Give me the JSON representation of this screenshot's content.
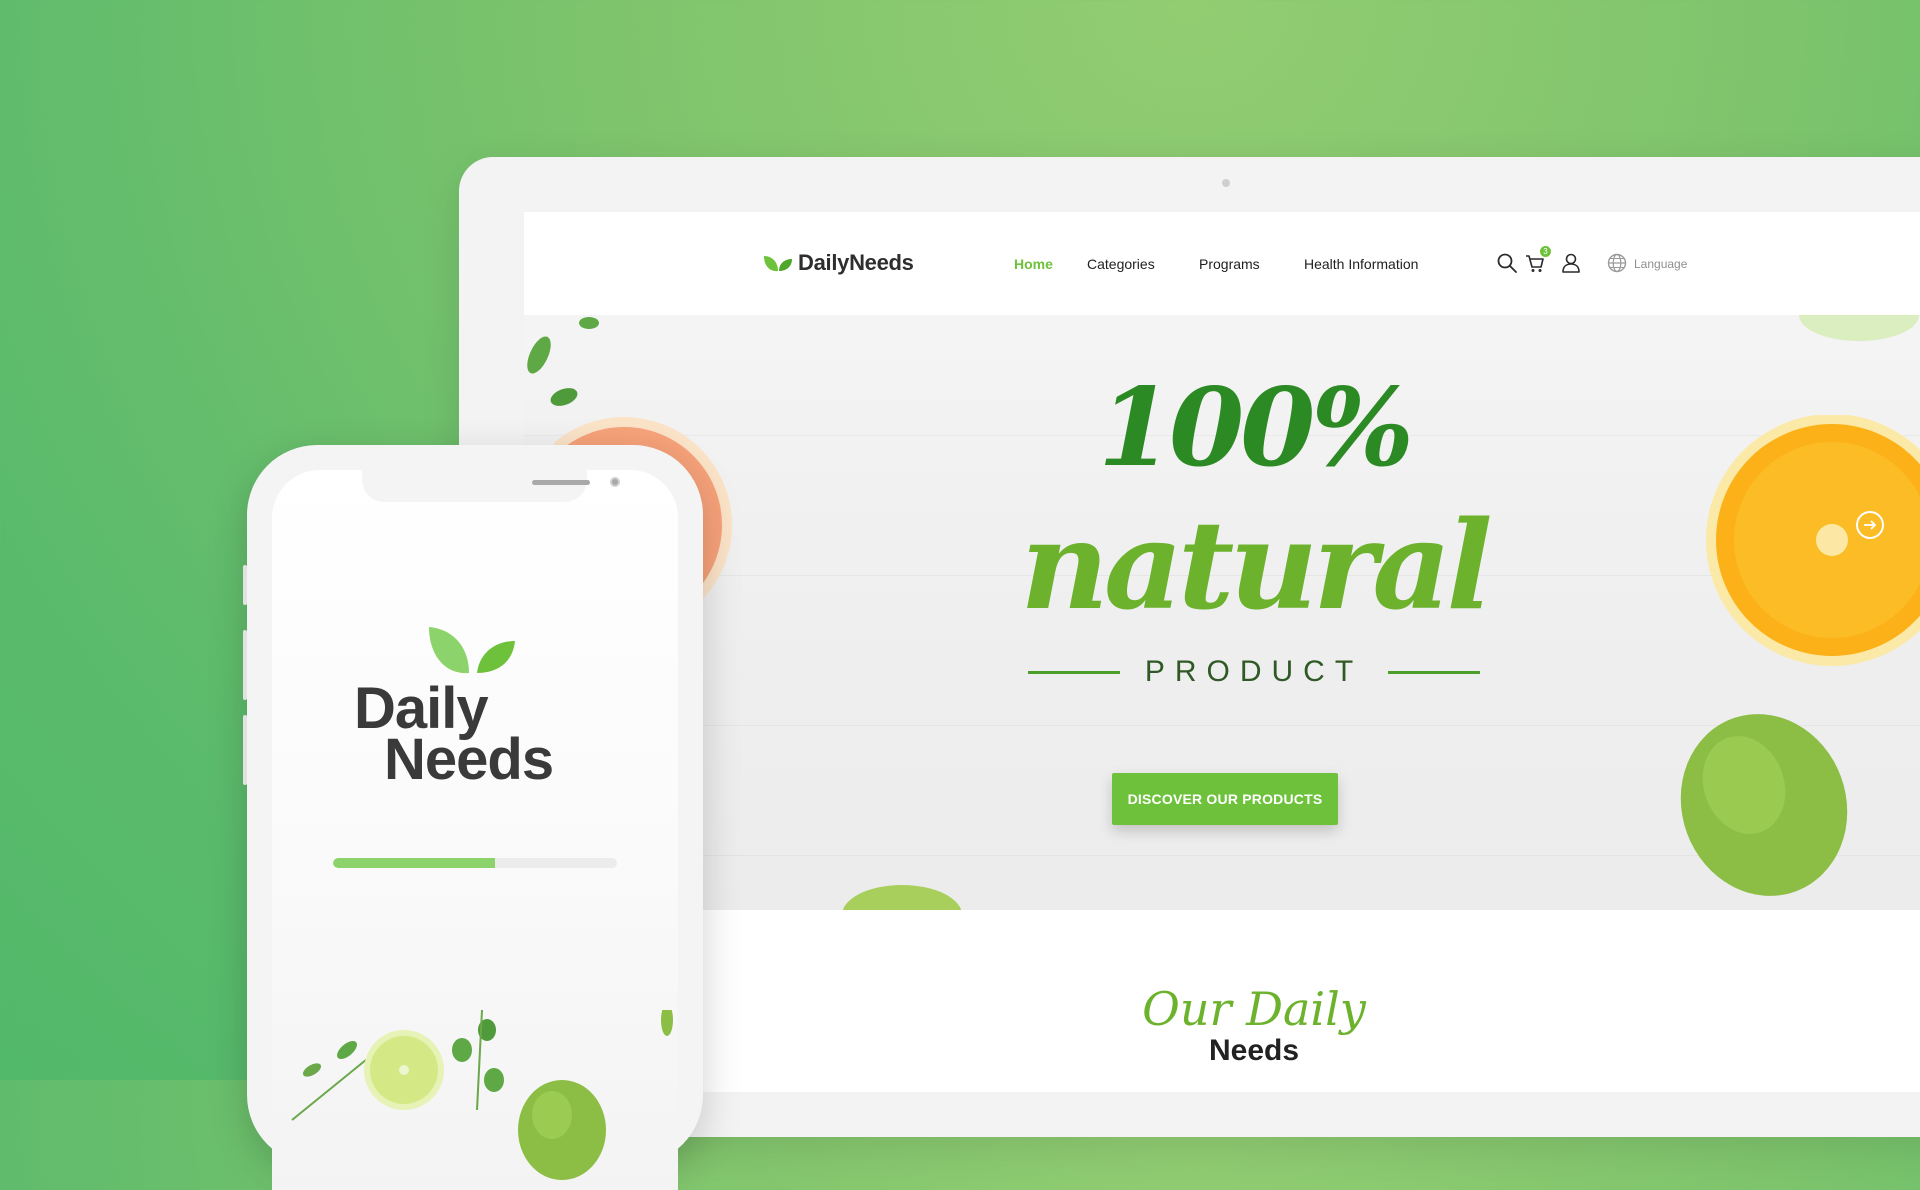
{
  "desktop": {
    "logo_text": "DailyNeeds",
    "nav": {
      "items": [
        {
          "label": "Home",
          "active": true
        },
        {
          "label": "Categories",
          "active": false
        },
        {
          "label": "Programs",
          "active": false
        },
        {
          "label": "Health Information",
          "active": false
        }
      ],
      "icons": [
        "search-icon",
        "cart-icon",
        "user-icon",
        "globe-icon"
      ],
      "cart_count": "3",
      "language_label": "Language"
    },
    "hero": {
      "headline_line1": "100%",
      "headline_line2": "natural",
      "headline_line3": "PRODUCT",
      "cta_label": "DISCOVER OUR PRODUCTS",
      "next_icon": "arrow-right-circle-icon"
    },
    "section": {
      "script_title": "Our Daily",
      "bold_title": "Needs"
    }
  },
  "mobile": {
    "logo_line1": "Daily",
    "logo_line2": "Needs",
    "loading_progress": 0.57
  },
  "colors": {
    "brand_green": "#6ec23b",
    "dark_green": "#2c8a24",
    "background_green": "#7ec46c",
    "text_dark": "#2e2e2e"
  }
}
